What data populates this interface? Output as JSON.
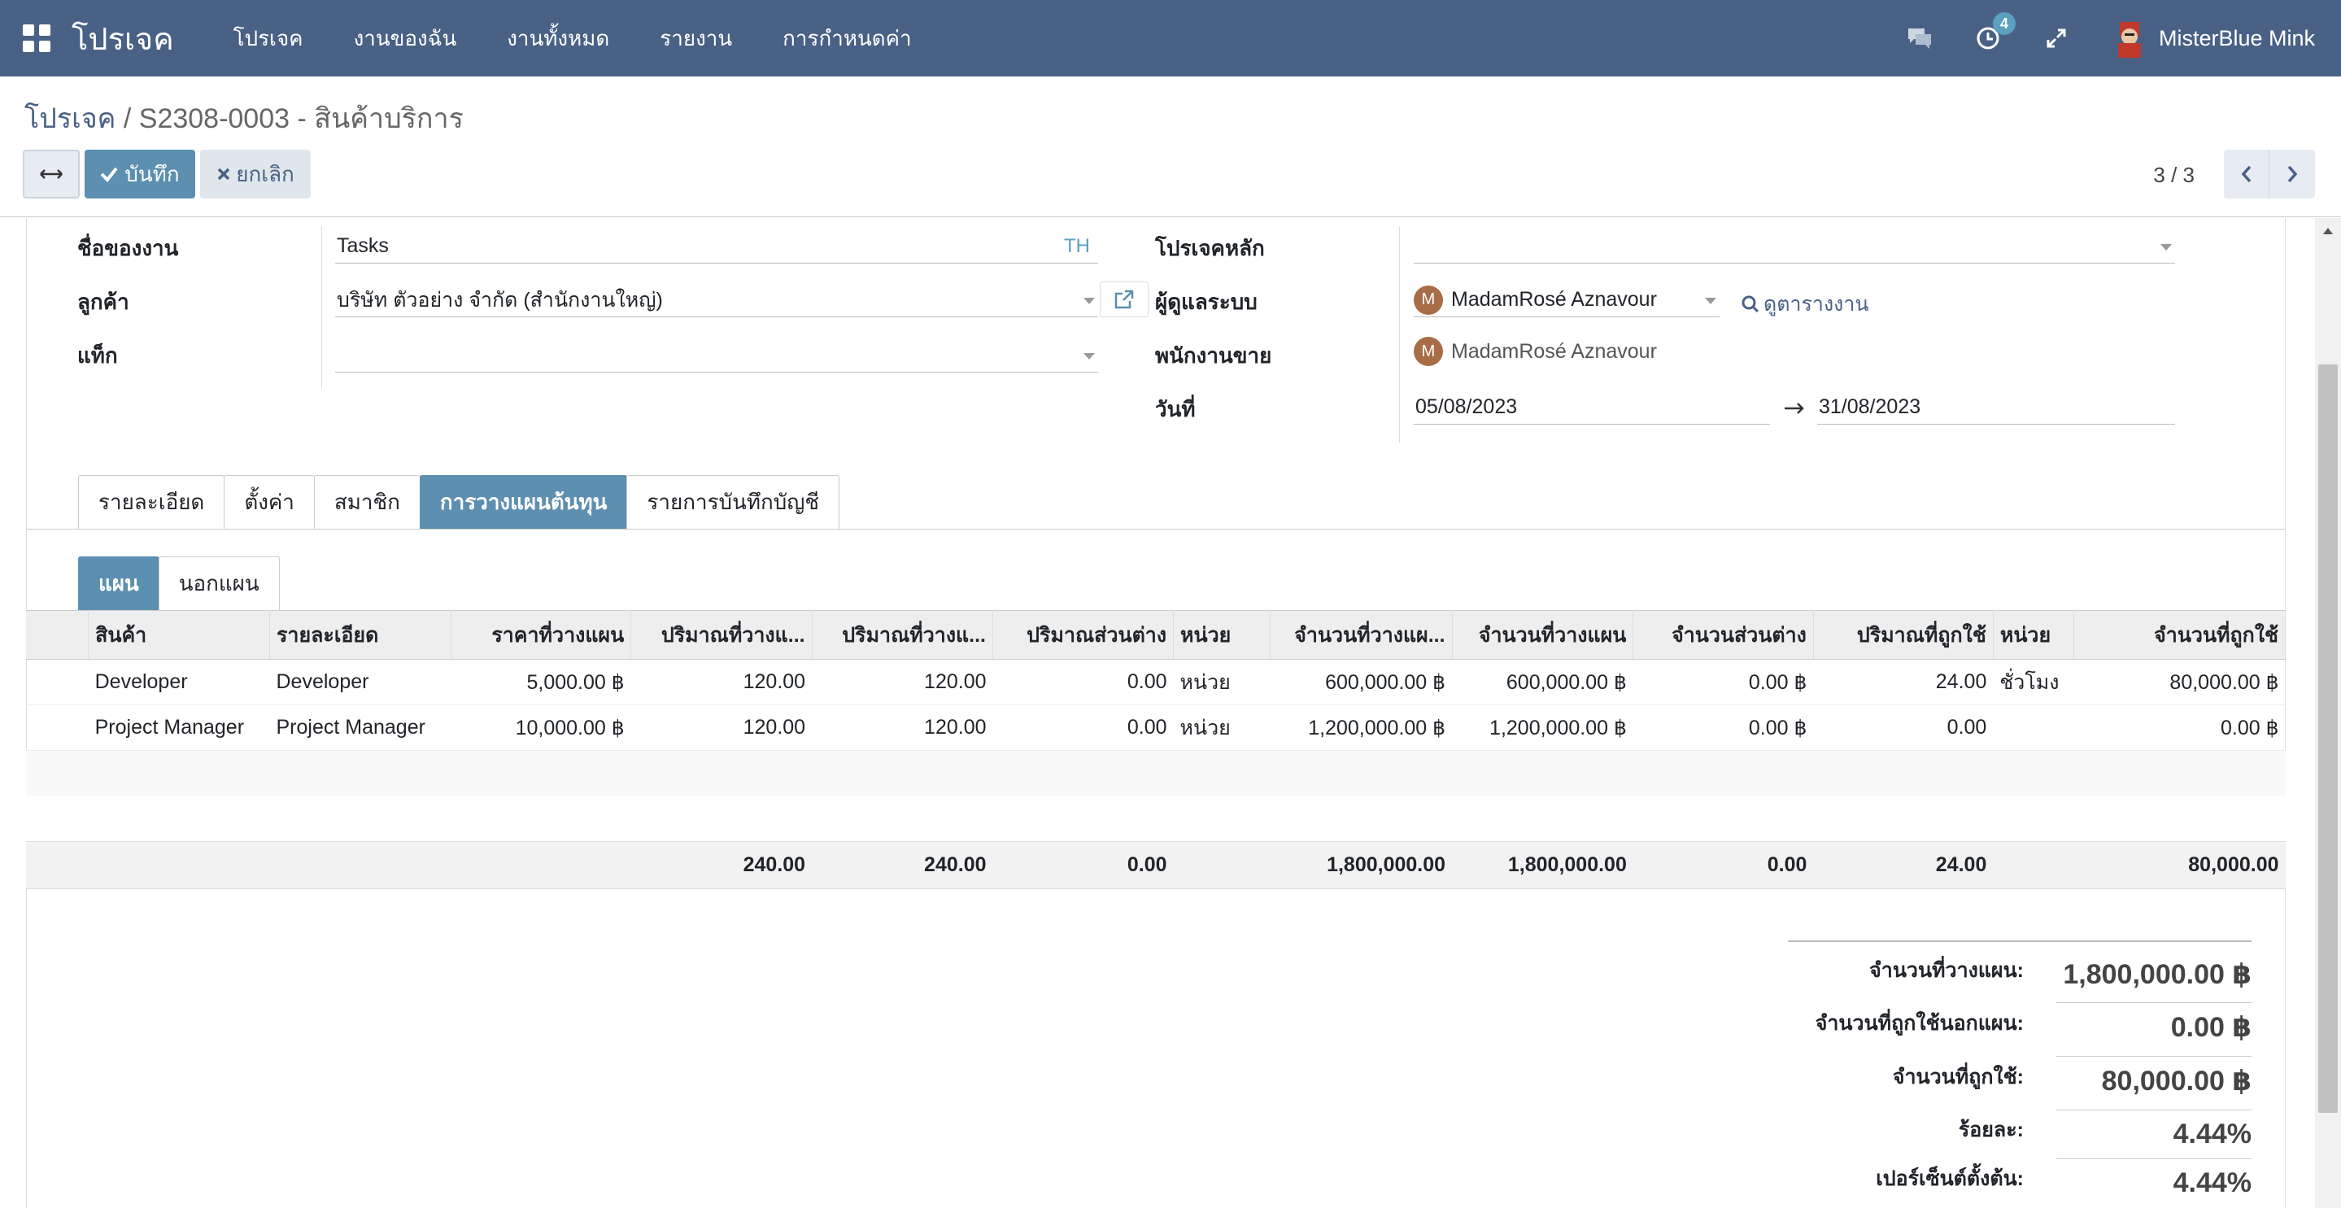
{
  "navbar": {
    "brand": "โปรเจค",
    "menu": [
      "โปรเจค",
      "งานของฉัน",
      "งานทั้งหมด",
      "รายงาน",
      "การกำหนดค่า"
    ],
    "activity_count": "4",
    "user_name": "MisterBlue Mink"
  },
  "breadcrumb": {
    "parent": "โปรเจค",
    "current": "S2308-0003 - สินค้าบริการ"
  },
  "buttons": {
    "save": "บันทึก",
    "discard": "ยกเลิก"
  },
  "pager": "3 / 3",
  "form": {
    "task_name_label": "ชื่อของงาน",
    "task_name": "Tasks",
    "lang": "TH",
    "customer_label": "ลูกค้า",
    "customer": "บริษัท ตัวอย่าง จำกัด (สำนักงานใหญ่)",
    "tags_label": "แท็ก",
    "parent_project_label": "โปรเจคหลัก",
    "admin_label": "ผู้ดูแลระบบ",
    "admin": "MadamRosé Aznavour",
    "admin_initial": "M",
    "view_schedule": "ดูตารางงาน",
    "salesperson_label": "พนักงานขาย",
    "salesperson": "MadamRosé Aznavour",
    "date_label": "วันที่",
    "date_start": "05/08/2023",
    "date_end": "31/08/2023"
  },
  "tabs": [
    "รายละเอียด",
    "ตั้งค่า",
    "สมาชิก",
    "การวางแผนต้นทุน",
    "รายการบันทึกบัญชี"
  ],
  "subtabs": [
    "แผน",
    "นอกแผน"
  ],
  "table": {
    "headers": [
      "สินค้า",
      "รายละเอียด",
      "ราคาที่วางแผน",
      "ปริมาณที่วางแ...",
      "ปริมาณที่วางแ...",
      "ปริมาณส่วนต่าง",
      "หน่วย",
      "จำนวนที่วางแผ...",
      "จำนวนที่วางแผน",
      "จำนวนส่วนต่าง",
      "ปริมาณที่ถูกใช้",
      "หน่วย",
      "จำนวนที่ถูกใช้"
    ],
    "rows": [
      [
        "Developer",
        "Developer",
        "5,000.00 ฿",
        "120.00",
        "120.00",
        "0.00",
        "หน่วย",
        "600,000.00 ฿",
        "600,000.00 ฿",
        "0.00 ฿",
        "24.00",
        "ชั่วโมง",
        "80,000.00 ฿"
      ],
      [
        "Project Manager",
        "Project Manager",
        "10,000.00 ฿",
        "120.00",
        "120.00",
        "0.00",
        "หน่วย",
        "1,200,000.00 ฿",
        "1,200,000.00 ฿",
        "0.00 ฿",
        "0.00",
        "",
        "0.00 ฿"
      ]
    ],
    "footer": [
      "",
      "",
      "",
      "240.00",
      "240.00",
      "0.00",
      "",
      "1,800,000.00",
      "1,800,000.00",
      "0.00",
      "24.00",
      "",
      "80,000.00"
    ]
  },
  "summary": [
    {
      "label": "จำนวนที่วางแผน:",
      "value": "1,800,000.00 ฿"
    },
    {
      "label": "จำนวนที่ถูกใช้นอกแผน:",
      "value": "0.00 ฿"
    },
    {
      "label": "จำนวนที่ถูกใช้:",
      "value": "80,000.00 ฿"
    },
    {
      "label": "ร้อยละ:",
      "value": "4.44%"
    },
    {
      "label": "เปอร์เซ็นต์ตั้งต้น:",
      "value": "4.44%"
    }
  ],
  "colors": {
    "navbar": "#4a6186",
    "accent": "#5d8fb0",
    "avatar": "#a86d46"
  }
}
